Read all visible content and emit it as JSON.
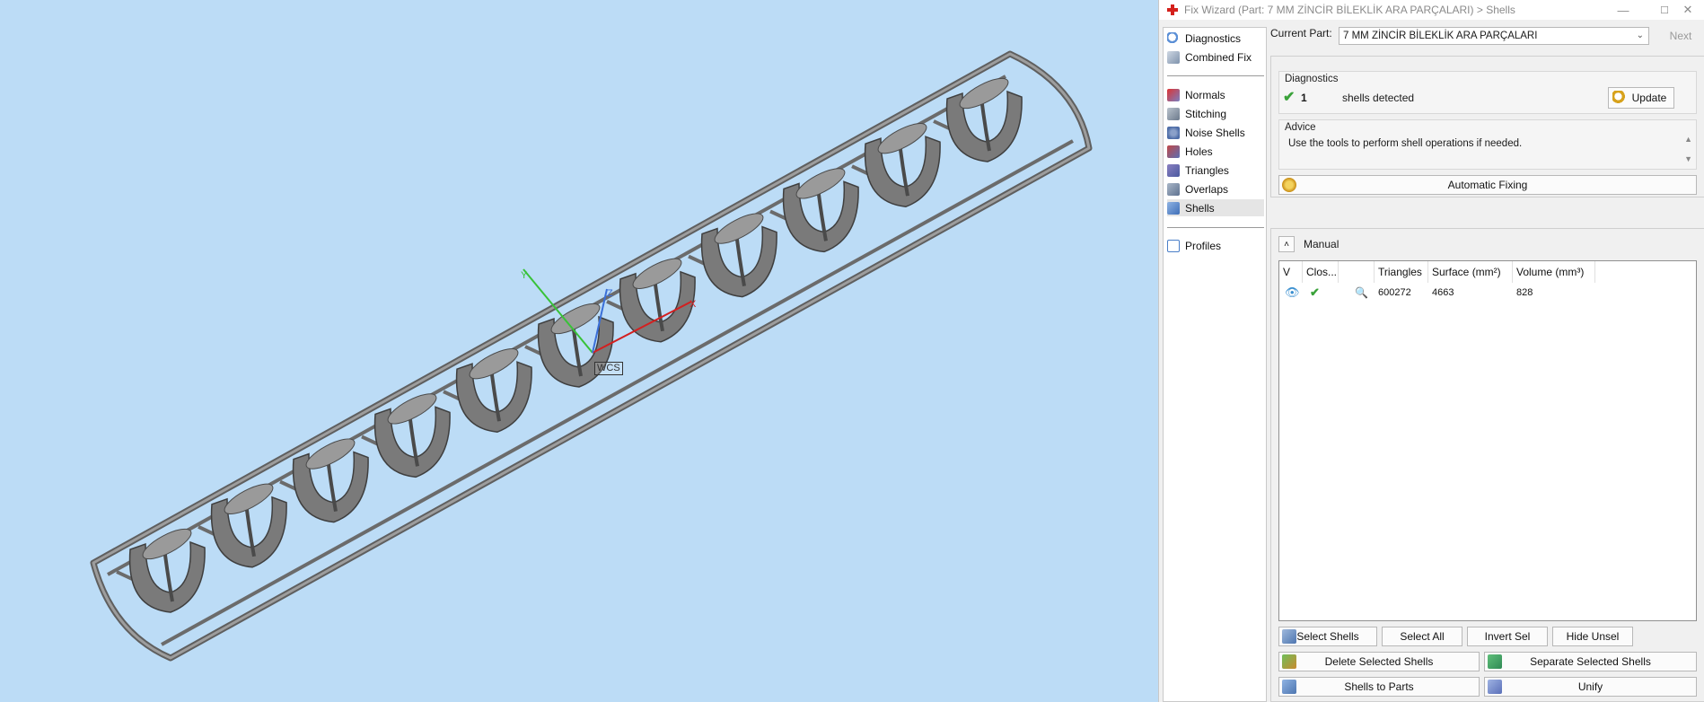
{
  "window": {
    "title": "Fix Wizard (Part: 7 MM ZİNCİR BİLEKLİK ARA PARÇALARI) > Shells",
    "controls": [
      "—",
      "☐",
      "✕"
    ]
  },
  "viewport": {
    "wcs_label": "WCS",
    "axes": {
      "x": "X",
      "y": "Y",
      "z": "Z"
    },
    "colors": {
      "background": "#bcdcf6",
      "part": "#6f6f6f",
      "x_axis": "#d32020",
      "y_axis": "#38c238",
      "z_axis": "#3a6fd8"
    }
  },
  "nav": {
    "top": [
      {
        "label": "Diagnostics",
        "icon": "magnifier-icon"
      },
      {
        "label": "Combined Fix",
        "icon": "combined-fix-icon"
      }
    ],
    "tools": [
      {
        "label": "Normals",
        "icon": "normals-icon"
      },
      {
        "label": "Stitching",
        "icon": "stitching-icon"
      },
      {
        "label": "Noise Shells",
        "icon": "noise-shells-icon"
      },
      {
        "label": "Holes",
        "icon": "holes-icon"
      },
      {
        "label": "Triangles",
        "icon": "triangles-icon"
      },
      {
        "label": "Overlaps",
        "icon": "overlaps-icon"
      },
      {
        "label": "Shells",
        "icon": "shells-icon",
        "selected": true
      }
    ],
    "bottom": [
      {
        "label": "Profiles",
        "icon": "profiles-icon"
      }
    ]
  },
  "current_part": {
    "label": "Current Part:",
    "value": "7 MM ZİNCİR BİLEKLİK ARA PARÇALARI",
    "next_label": "Next"
  },
  "diagnostics": {
    "title": "Diagnostics",
    "count": "1",
    "text": "shells detected",
    "update_label": "Update",
    "advice_title": "Advice",
    "advice_text": "Use the tools to perform shell operations if needed.",
    "auto_fix_label": "Automatic Fixing"
  },
  "manual": {
    "title": "Manual",
    "columns": [
      "V",
      "Clos...",
      "",
      "Triangles",
      "Surface (mm²)",
      "Volume (mm³)"
    ],
    "rows": [
      {
        "triangles": "600272",
        "surface": "4663",
        "volume": "828"
      }
    ],
    "buttons": {
      "select_shells": "Select Shells",
      "select_all": "Select All",
      "invert_sel": "Invert Sel",
      "hide_unsel": "Hide Unsel",
      "delete_selected": "Delete Selected Shells",
      "separate_selected": "Separate Selected Shells",
      "shells_to_parts": "Shells to Parts",
      "unify": "Unify"
    }
  }
}
